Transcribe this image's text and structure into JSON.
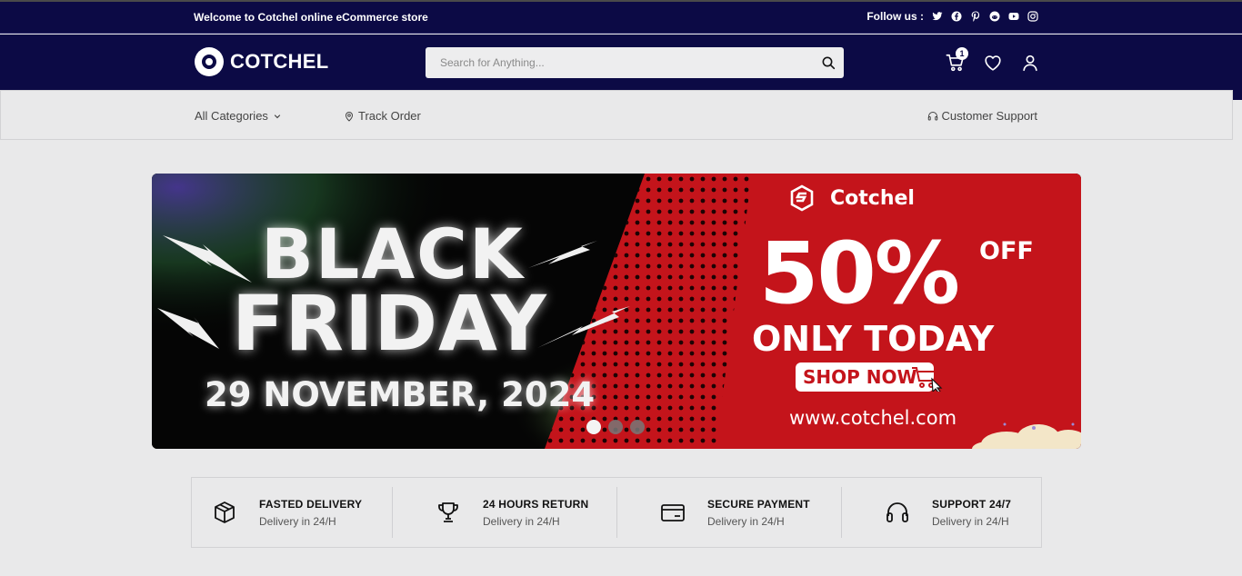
{
  "topbar": {
    "welcome_text": "Welcome to Cotchel online eCommerce store",
    "follow_label": "Follow us :",
    "social_icons": [
      "twitter-icon",
      "facebook-icon",
      "pinterest-icon",
      "reddit-icon",
      "youtube-icon",
      "instagram-icon"
    ]
  },
  "header": {
    "logo_text": "COTCHEL",
    "search_placeholder": "Search for Anything...",
    "cart_count": "1",
    "colors": {
      "navy": "#0c0a45",
      "banner_red": "#c4141b"
    }
  },
  "nav": {
    "categories_label": "All Categories",
    "track_order_label": "Track Order",
    "customer_support_label": "Customer Support"
  },
  "banner": {
    "headline_1": "BLACK",
    "headline_2": "FRIDAY",
    "date": "29 NOVEMBER, 2024",
    "brand": "Cotchel",
    "discount": "50%",
    "off": "OFF",
    "only_today": "ONLY TODAY",
    "shop_now": "SHOP NOW",
    "url": "www.cotchel.com",
    "slides": 3,
    "active_slide": 1
  },
  "features": [
    {
      "icon": "box-icon",
      "title": "FASTED DELIVERY",
      "subtitle": "Delivery in 24/H"
    },
    {
      "icon": "trophy-icon",
      "title": "24 HOURS RETURN",
      "subtitle": "Delivery in 24/H"
    },
    {
      "icon": "credit-card-icon",
      "title": "SECURE PAYMENT",
      "subtitle": "Delivery in 24/H"
    },
    {
      "icon": "headphones-icon",
      "title": "SUPPORT 24/7",
      "subtitle": "Delivery in 24/H"
    }
  ]
}
